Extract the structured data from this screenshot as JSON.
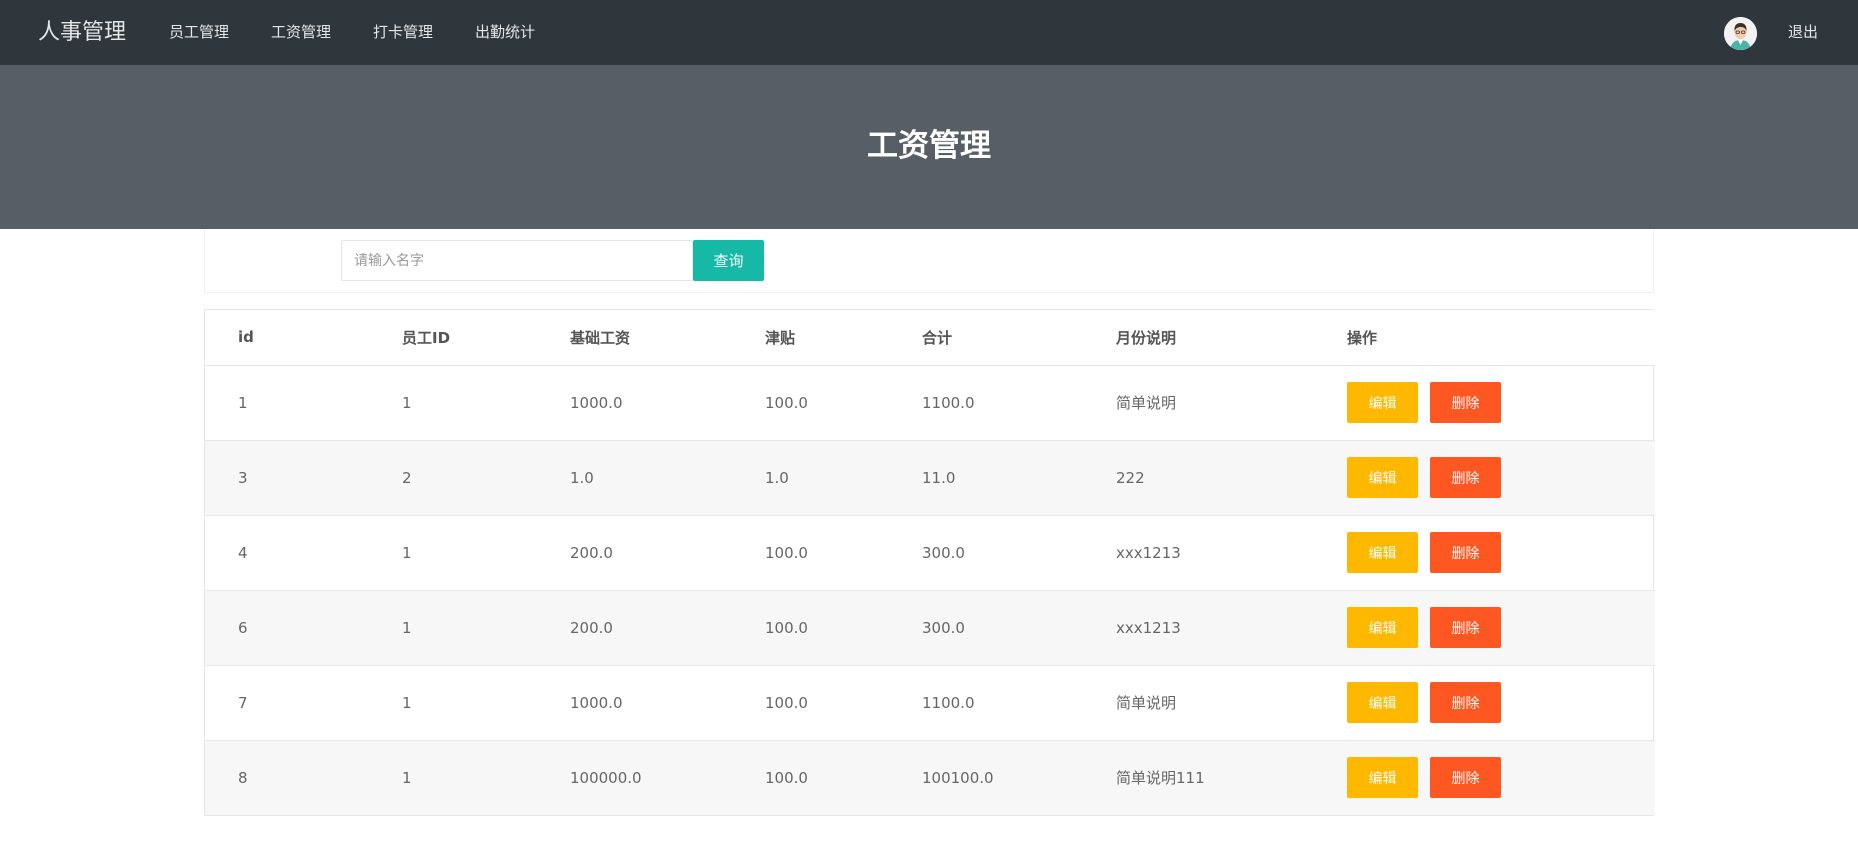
{
  "header": {
    "brand": "人事管理",
    "nav": [
      "员工管理",
      "工资管理",
      "打卡管理",
      "出勤统计"
    ],
    "logout": "退出"
  },
  "banner": {
    "title": "工资管理"
  },
  "search": {
    "placeholder": "请输入名字",
    "value": "",
    "button": "查询"
  },
  "table": {
    "columns": [
      "id",
      "员工ID",
      "基础工资",
      "津贴",
      "合计",
      "月份说明",
      "操作"
    ],
    "rows": [
      {
        "id": "1",
        "emp_id": "1",
        "base": "1000.0",
        "allowance": "100.0",
        "total": "1100.0",
        "note": "简单说明"
      },
      {
        "id": "3",
        "emp_id": "2",
        "base": "1.0",
        "allowance": "1.0",
        "total": "11.0",
        "note": "222"
      },
      {
        "id": "4",
        "emp_id": "1",
        "base": "200.0",
        "allowance": "100.0",
        "total": "300.0",
        "note": "xxx1213"
      },
      {
        "id": "6",
        "emp_id": "1",
        "base": "200.0",
        "allowance": "100.0",
        "total": "300.0",
        "note": "xxx1213"
      },
      {
        "id": "7",
        "emp_id": "1",
        "base": "1000.0",
        "allowance": "100.0",
        "total": "1100.0",
        "note": "简单说明"
      },
      {
        "id": "8",
        "emp_id": "1",
        "base": "100000.0",
        "allowance": "100.0",
        "total": "100100.0",
        "note": "简单说明111"
      }
    ],
    "edit_label": "编辑",
    "delete_label": "删除"
  },
  "colors": {
    "topbar": "#2f363c",
    "banner": "#575e66",
    "search": "#16b8a6",
    "edit": "#ffb800",
    "delete": "#ff5722"
  }
}
